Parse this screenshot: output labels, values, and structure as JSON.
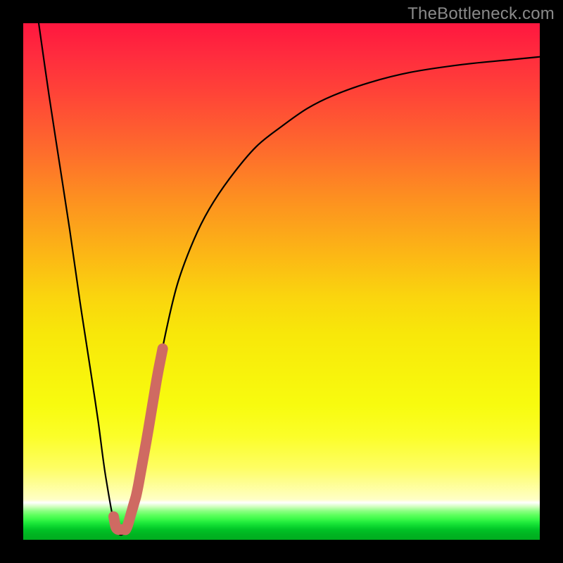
{
  "watermark": "TheBottleneck.com",
  "colors": {
    "curve": "#000000",
    "overlay": "#cf6a62",
    "background_top": "#ff173f",
    "background_bottom": "#00ad1f"
  },
  "chart_data": {
    "type": "line",
    "title": "",
    "xlabel": "",
    "ylabel": "",
    "xlim": [
      0,
      100
    ],
    "ylim": [
      0,
      100
    ],
    "grid": false,
    "series": [
      {
        "name": "bottleneck-curve",
        "x": [
          3,
          5,
          7,
          9,
          11,
          13,
          14.5,
          16,
          18,
          20,
          22,
          24,
          26,
          28,
          30,
          33,
          36,
          40,
          45,
          50,
          55,
          60,
          67,
          75,
          85,
          95,
          100
        ],
        "y": [
          100,
          86,
          73,
          60,
          46,
          33,
          23,
          12,
          2,
          2,
          9,
          20,
          32,
          42,
          50,
          58,
          64,
          70,
          76,
          80,
          83.5,
          86,
          88.5,
          90.5,
          92,
          93,
          93.5
        ]
      }
    ],
    "overlay_segment": {
      "name": "highlight-range",
      "x_start": 17.5,
      "x_end": 27.0,
      "color": "#cf6a62"
    }
  }
}
